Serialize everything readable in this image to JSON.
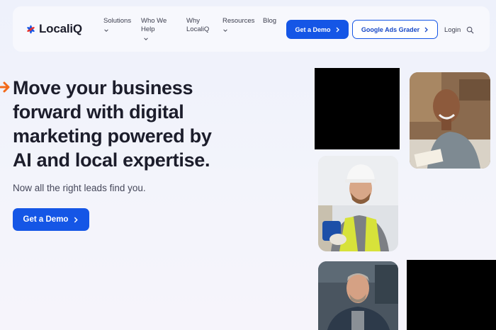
{
  "header": {
    "logo_text": "LocaliQ",
    "nav": [
      {
        "label": "Solutions",
        "has_menu": true
      },
      {
        "label": "Who We Help",
        "has_menu": true
      },
      {
        "label": "Why LocaliQ",
        "has_menu": false
      },
      {
        "label": "Resources",
        "has_menu": true
      },
      {
        "label": "Blog",
        "has_menu": false
      }
    ],
    "demo_button": "Get a Demo",
    "grader_button": "Google Ads Grader",
    "login": "Login"
  },
  "hero": {
    "headline_bold_1": "Move your business",
    "headline_bold_2": "forward",
    "headline_rest_1": " with digital",
    "headline_rest_2": "marketing powered by",
    "headline_rest_3": "AI and local expertise.",
    "subheadline": "Now all the right leads find you.",
    "cta": "Get a Demo"
  },
  "colors": {
    "primary": "#1556e6",
    "accent_arrow": "#f26a1b",
    "text_dark": "#1c1d2b"
  },
  "icons": [
    "logo-asterisk-icon",
    "chevron-down-icon",
    "chevron-right-icon",
    "search-icon",
    "arrow-right-icon"
  ]
}
